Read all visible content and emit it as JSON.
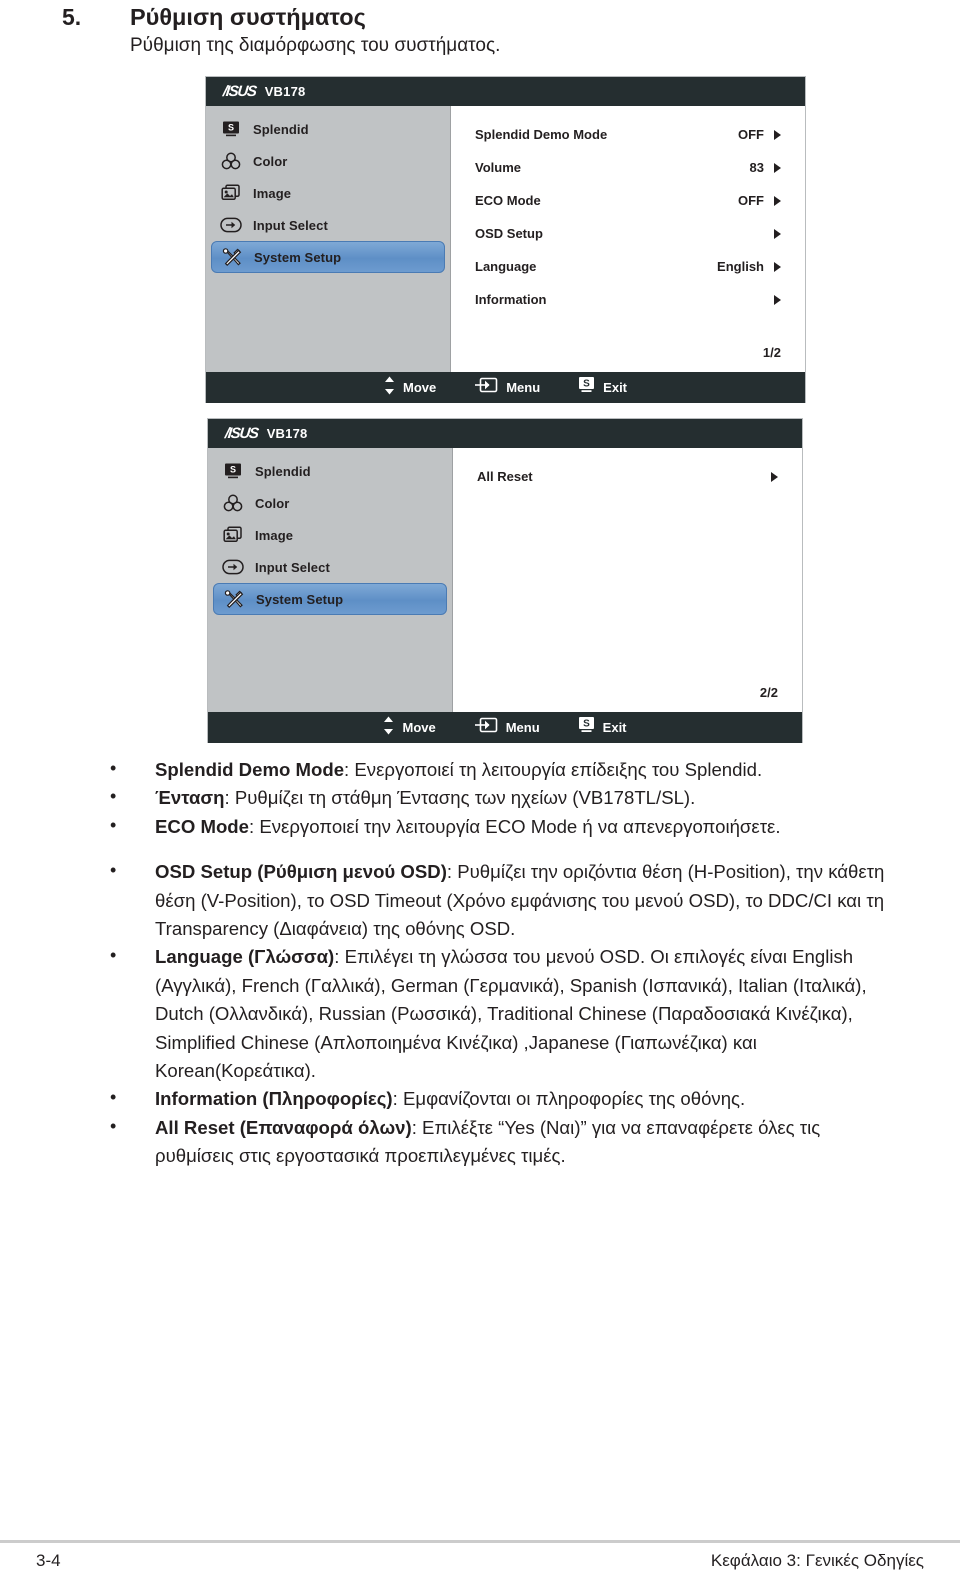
{
  "section": {
    "number": "5.",
    "title": "Ρύθμιση συστήματος",
    "subtitle": "Ρύθμιση της διαμόρφωσης του συστήματος."
  },
  "osd": {
    "brand": "/ISUS",
    "model": "VB178",
    "sidebar": [
      {
        "label": "Splendid",
        "icon": "splendid-icon"
      },
      {
        "label": "Color",
        "icon": "color-icon"
      },
      {
        "label": "Image",
        "icon": "image-icon"
      },
      {
        "label": "Input Select",
        "icon": "input-select-icon"
      },
      {
        "label": "System Setup",
        "icon": "system-setup-icon"
      }
    ],
    "footer": [
      {
        "label": "Move",
        "icon": "updown-arrows-icon"
      },
      {
        "label": "Menu",
        "icon": "menu-enter-icon"
      },
      {
        "label": "Exit",
        "icon": "splendid-s-icon"
      }
    ],
    "page1": {
      "page_indicator": "1/2",
      "options": [
        {
          "name": "Splendid Demo Mode",
          "value": "OFF"
        },
        {
          "name": "Volume",
          "value": "83"
        },
        {
          "name": "ECO Mode",
          "value": "OFF"
        },
        {
          "name": "OSD Setup",
          "value": ""
        },
        {
          "name": "Language",
          "value": "English"
        },
        {
          "name": "Information",
          "value": ""
        }
      ]
    },
    "page2": {
      "page_indicator": "2/2",
      "options": [
        {
          "name": "All Reset",
          "value": ""
        }
      ]
    }
  },
  "bullets": [
    {
      "bold": "Splendid Demo Mode",
      "rest": ": Ενεργοποιεί τη λειτουργία επίδειξης του Splendid."
    },
    {
      "bold": "Ένταση",
      "rest": ": Ρυθμίζει τη στάθμη Έντασης των ηχείων (VB178TL/SL)."
    },
    {
      "bold": "ECO Mode",
      "rest": ": Ενεργοποιεί την λειτουργία ECO Mode ή να απενεργοποιήσετε."
    },
    {
      "bold": "OSD Setup (Ρύθμιση μενού OSD)",
      "rest": ": Ρυθμίζει την οριζόντια θέση (H-Position), την κάθετη θέση (V-Position), το OSD Timeout (Χρόνο εμφάνισης του μενού OSD), το DDC/CI και τη Transparency (Διαφάνεια) της οθόνης OSD."
    },
    {
      "bold": "Language (Γλώσσα)",
      "rest": ": Επιλέγει τη γλώσσα του μενού OSD. Οι επιλογές είναι English (Αγγλικά), French (Γαλλικά), German (Γερμανικά), Spanish (Ισπανικά), Italian (Ιταλικά), Dutch (Ολλανδικά), Russian (Ρωσσικά), Traditional Chinese (Παραδοσιακά Κινέζικα), Simplified Chinese (Απλοποιημένα Κινέζικα) ,Japanese (Γιαπωνέζικα) και Korean(Κορεάτικα)."
    },
    {
      "bold": "Information (Πληροφορίες)",
      "rest": ": Εμφανίζονται οι πληροφορίες της οθόνης."
    },
    {
      "bold": "All Reset (Επαναφορά όλων)",
      "rest": ": Επιλέξτε “Yes (Ναι)” για να επαναφέρετε όλες τις ρυθμίσεις στις εργοστασικά προεπιλεγμένες τιμές."
    }
  ],
  "footer": {
    "page": "3-4",
    "chapter": "Κεφάλαιο 3: Γενικές Οδηγίες"
  },
  "colors": {
    "osd_title_bar": "#252e30",
    "osd_sidebar": "#c0c3c5",
    "osd_highlight": "#5e8fc6",
    "text": "#231f20"
  }
}
